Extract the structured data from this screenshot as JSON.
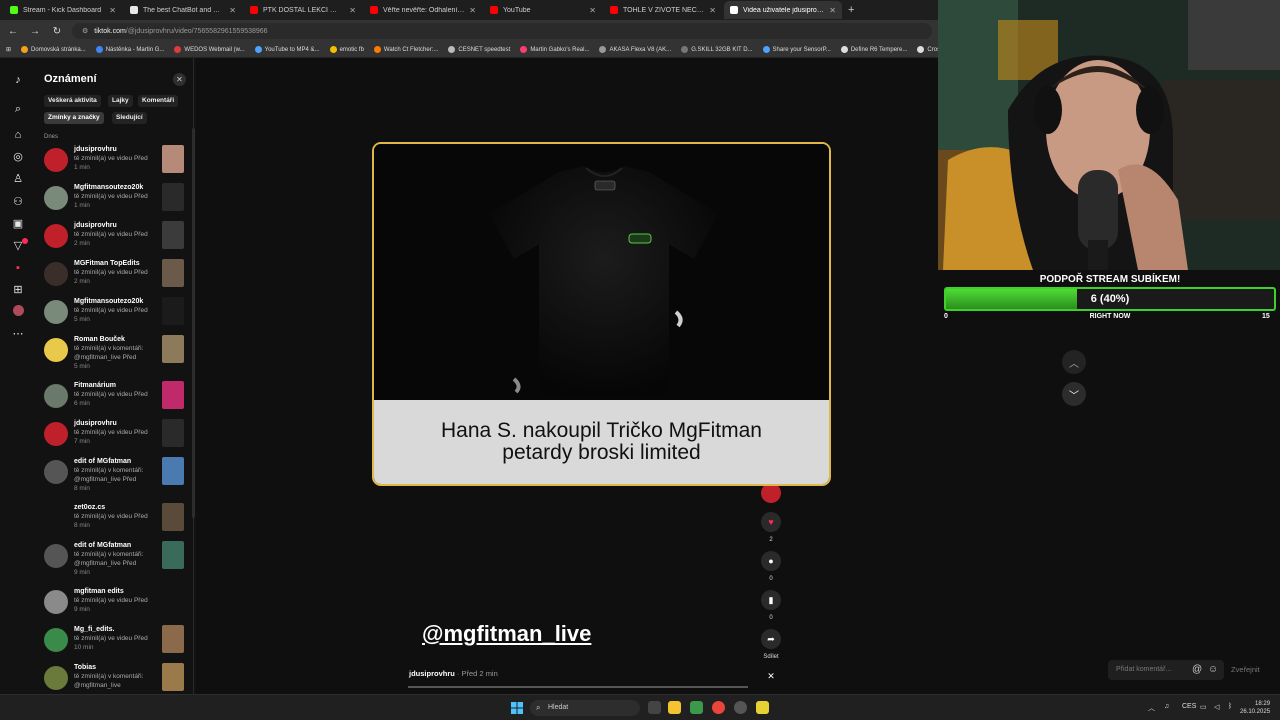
{
  "browser": {
    "tabs": [
      {
        "label": "Stream - Kick Dashboard",
        "color": "#53fc18",
        "active": false
      },
      {
        "label": "The best ChatBot and Widgets",
        "color": "#e8e8e8",
        "active": false
      },
      {
        "label": "PTK DOSTAL LEKCI 🔴 - YouTube",
        "color": "#ff0000",
        "active": false
      },
      {
        "label": "Věřte nevěřte: Odhalení největší",
        "color": "#ff0000",
        "active": false
      },
      {
        "label": "YouTube",
        "color": "#ff0000",
        "active": false
      },
      {
        "label": "TOHLE V ŽIVOTĚ NEČEKALI - YouTube",
        "color": "#ff0000",
        "active": false
      },
      {
        "label": "Videa uživatele jdusiprovhru | TikTok",
        "color": "#ffffff",
        "active": true
      }
    ],
    "url_host": "tiktok.com",
    "url_path": "/@jdusiprovhru/video/7565582961559538966",
    "bookmarks": [
      {
        "label": "Domovská stránka...",
        "color": "#f2a31b"
      },
      {
        "label": "Nástěnka - Martin G...",
        "color": "#4285f4"
      },
      {
        "label": "WEDOS Webmail (w...",
        "color": "#e03a3a"
      },
      {
        "label": "YouTube to MP4 &...",
        "color": "#4da3ff"
      },
      {
        "label": "emotic fb",
        "color": "#f0c000"
      },
      {
        "label": "Watch Ct Fletcher:...",
        "color": "#ff7a00"
      },
      {
        "label": "CESNET speedtest",
        "color": "#bbbbbb"
      },
      {
        "label": "Martin Gabko's Real...",
        "color": "#ff3d6e"
      },
      {
        "label": "AKASA Flexa V8 (AK...",
        "color": "#999999"
      },
      {
        "label": "G.SKILL 32GB KIT D...",
        "color": "#777777"
      },
      {
        "label": "Share your SensorP...",
        "color": "#4da3ff"
      },
      {
        "label": "Define R6 Tempere...",
        "color": "#dddddd"
      },
      {
        "label": "Crossa",
        "color": "#dddddd"
      }
    ]
  },
  "notifications": {
    "title": "Oznámení",
    "filters": [
      "Veškerá aktivita",
      "Lajky",
      "Komentáři"
    ],
    "filters2": [
      "Zmínky a značky",
      "Sledující"
    ],
    "selected_filter": "Zmínky a značky",
    "section": "Dnes",
    "items": [
      {
        "name": "jdusiprovhru",
        "action": "tě zmínil(a) ve videu Před",
        "time": "1 min",
        "avatar": "#c0202a",
        "thumb": "#b68a78"
      },
      {
        "name": "Mgfitmansoutezo20k",
        "action": "tě zmínil(a) ve videu Před",
        "time": "1 min",
        "avatar": "#7a8a7a",
        "thumb": "#2a2a2a"
      },
      {
        "name": "jdusiprovhru",
        "action": "tě zmínil(a) ve videu Před",
        "time": "2 min",
        "avatar": "#c0202a",
        "thumb": "#3b3b3b"
      },
      {
        "name": "MGFitman TopEdits",
        "action": "tě zmínil(a) ve videu Před",
        "time": "2 min",
        "avatar": "#3a2e2a",
        "thumb": "#6b5a4a"
      },
      {
        "name": "Mgfitmansoutezo20k",
        "action": "tě zmínil(a) ve videu Před",
        "time": "5 min",
        "avatar": "#7a8a7a",
        "thumb": "#1b1b1b"
      },
      {
        "name": "Roman Bouček",
        "action": "tě zmínil(a) v komentáři: @mgfitman_live Před",
        "time": "5 min",
        "avatar": "#e9c94a",
        "thumb": "#8c7a5a"
      },
      {
        "name": "Fitmanárium",
        "action": "tě zmínil(a) ve videu Před",
        "time": "6 min",
        "avatar": "#6a7a6a",
        "thumb": "#c02a6a"
      },
      {
        "name": "jdusiprovhru",
        "action": "tě zmínil(a) ve videu Před",
        "time": "7 min",
        "avatar": "#c0202a",
        "thumb": "#2a2a2a"
      },
      {
        "name": "edit of MGfatman",
        "action": "tě zmínil(a) v komentáři: @mgfitman_live Před",
        "time": "8 min",
        "avatar": "#555555",
        "thumb": "#4a7ab0"
      },
      {
        "name": "zet0oz.cs",
        "action": "tě zmínil(a) ve videu Před",
        "time": "8 min",
        "avatar": "#121212",
        "thumb": "#5a4a3a"
      },
      {
        "name": "edit of MGfatman",
        "action": "tě zmínil(a) v komentáři: @mgfitman_live Před",
        "time": "9 min",
        "avatar": "#555555",
        "thumb": "#3a6a5a"
      },
      {
        "name": "mgfitman edits",
        "action": "tě zmínil(a) ve videu Před",
        "time": "9 min",
        "avatar": "#8a8a8a",
        "thumb": "#121212"
      },
      {
        "name": "Mg_fi_edits.",
        "action": "tě zmínil(a) ve videu Před",
        "time": "10 min",
        "avatar": "#3a8a4a",
        "thumb": "#8a6a4a"
      },
      {
        "name": "Tobias",
        "action": "tě zmínil(a) v komentáři: @mgfitman_live",
        "time": "",
        "avatar": "#6a7a3a",
        "thumb": "#9a7a4a"
      }
    ]
  },
  "popup": {
    "caption_line1": "Hana S. nakoupil Tričko MgFitman",
    "caption_line2": "petardy broski limited"
  },
  "video": {
    "mention": "@mgfitman_live",
    "author": "jdusiprovhru",
    "posted": " · Před 2 min",
    "likes": "2",
    "comments": "0",
    "saves": "0",
    "share_label": "Sdílet"
  },
  "comments": {
    "placeholder": "Přidat komentář...",
    "publish": "Zveřejnit"
  },
  "stream_goal": {
    "title": "PODPOŘ STREAM SUBÍKEM!",
    "value_text": "6 (40%)",
    "progress": 0.4,
    "min": "0",
    "now_label": "RIGHT NOW",
    "max": "15"
  },
  "taskbar": {
    "search": "Hledat",
    "lang": "CES",
    "time": "18:29",
    "date": "26.10.2025"
  }
}
